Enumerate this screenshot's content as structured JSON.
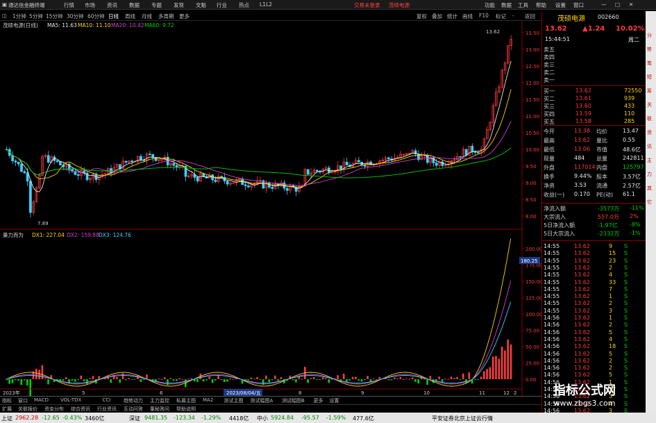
{
  "menubar": {
    "app": "通达信金融终端",
    "items": [
      "行情",
      "市场",
      "资讯",
      "数据",
      "专题",
      "发现",
      "文魁",
      "行业",
      "热点",
      "L1L2"
    ],
    "trade": "交易未登录",
    "stock_title": "茂硕电源",
    "right_items": [
      "功能",
      "数据",
      "工具",
      "帮助"
    ],
    "right2": [
      "设置",
      "窗口"
    ]
  },
  "tabbar": {
    "periods": [
      "1分钟",
      "5分钟",
      "15分钟",
      "30分钟",
      "60分钟",
      "日线",
      "周线",
      "月线",
      "多周期",
      "更多"
    ],
    "right": [
      "复权",
      "叠加",
      "统计",
      "画线",
      "F10",
      "标记",
      "-",
      "返回"
    ]
  },
  "kline": {
    "legend_name": "茂硕电源(日线)",
    "ma5": "MA5: 11.63",
    "ma10": "MA10: 11.10",
    "ma20": "MA20: 10.42",
    "ma60": "MA60: 9.72",
    "high_label": "13.62",
    "low_label": "7.89",
    "y_ticks": [
      "13.50",
      "13.00",
      "12.50",
      "12.00",
      "11.50",
      "11.00",
      "10.50",
      "10.00",
      "9.50",
      "9.00",
      "8.50",
      "8.00"
    ]
  },
  "indicator": {
    "name": "量力而为",
    "dx1": "DX1: 227.04",
    "dx2": "DX2: 159.88",
    "dx3": "DX3: 124.76",
    "cursor_value": "180.25",
    "y_ticks": [
      "200.00",
      "175.00",
      "150.00",
      "125.00",
      "100.00",
      "75.00",
      "50.00",
      "25.00",
      "0.00"
    ]
  },
  "date_axis": {
    "labels": [
      "2023年",
      "5",
      "6",
      "7",
      "8",
      "9",
      "10",
      "11",
      "12",
      "2"
    ],
    "cursor_date": "2023/08/04/五"
  },
  "bottom_tabs": [
    "指标",
    "窗口",
    "MACD",
    "VOL-TDX",
    "CCI",
    "趋势动力",
    "主力监控",
    "私募主图",
    "MA2",
    "测试主图",
    "测试幅图A",
    "测试幅图B",
    "更多",
    "设置"
  ],
  "bottom_tabs2": [
    "扩展",
    "关联报价",
    "资金分布",
    "综合资讯",
    "行业资讯",
    "互动问答",
    "董秘答问",
    "帮助说明"
  ],
  "quote": {
    "name": "茂硕电源",
    "code": "002660",
    "price": "13.62",
    "change": "▲1.24",
    "pct": "10.02%",
    "sell": [
      [
        "卖五",
        ""
      ],
      [
        "卖四",
        ""
      ],
      [
        "卖三",
        ""
      ],
      [
        "卖二",
        ""
      ],
      [
        "卖一",
        ""
      ]
    ],
    "buy": [
      [
        "买一",
        "13.62",
        "72550"
      ],
      [
        "买二",
        "13.61",
        "939"
      ],
      [
        "买三",
        "13.60",
        "433"
      ],
      [
        "买四",
        "13.59",
        "110"
      ],
      [
        "买五",
        "13.58",
        "285"
      ]
    ],
    "stats": [
      [
        "今开",
        "13.38",
        "均价",
        "13.47"
      ],
      [
        "最高",
        "13.62",
        "量比",
        "0.55"
      ],
      [
        "最低",
        "13.06",
        "市值",
        "48.6亿"
      ],
      [
        "现量",
        "484",
        "总量",
        "242811"
      ],
      [
        "外盘",
        "117014",
        "内盘",
        "125797"
      ],
      [
        "换手",
        "9.44%",
        "股本",
        "3.57亿"
      ],
      [
        "净资",
        "3.53",
        "流通",
        "2.57亿"
      ],
      [
        "收益(一)",
        "0.170",
        "PE(动)",
        "61.1"
      ]
    ],
    "flow": [
      [
        "净流入额",
        "-3573万",
        "-11%"
      ],
      [
        "大宗流入",
        "557.0万",
        "2%"
      ],
      [
        "5日净流入额",
        "-1.97亿",
        "-8%"
      ],
      [
        "5日大宗流入",
        "-2332万",
        "-1%"
      ]
    ],
    "ticks": [
      [
        "14:55",
        "13.62",
        "9",
        "S"
      ],
      [
        "14:55",
        "13.62",
        "15",
        "S"
      ],
      [
        "14:55",
        "13.62",
        "23",
        "S"
      ],
      [
        "14:55",
        "13.62",
        "2",
        "S"
      ],
      [
        "14:55",
        "13.62",
        "4",
        "S"
      ],
      [
        "14:55",
        "13.62",
        "33",
        "S"
      ],
      [
        "14:55",
        "13.62",
        "7",
        "S"
      ],
      [
        "14:55",
        "13.62",
        "1",
        "S"
      ],
      [
        "14:55",
        "13.62",
        "2",
        "S"
      ],
      [
        "14:55",
        "13.62",
        "3",
        "S"
      ],
      [
        "14:56",
        "13.62",
        "1",
        "S"
      ],
      [
        "14:56",
        "13.62",
        "2",
        "S"
      ],
      [
        "14:56",
        "13.62",
        "5",
        "S"
      ],
      [
        "14:56",
        "13.62",
        "4",
        "S"
      ],
      [
        "14:56",
        "13.62",
        "18",
        "S"
      ],
      [
        "14:56",
        "13.62",
        "5",
        "S"
      ],
      [
        "14:56",
        "13.62",
        "2",
        "S"
      ],
      [
        "14:56",
        "13.62",
        "2",
        "S"
      ],
      [
        "14:56",
        "13.62",
        "5",
        "S"
      ],
      [
        "14:56",
        "13.62",
        "1",
        "S"
      ],
      [
        "14:56",
        "13.62",
        "17",
        "S"
      ],
      [
        "14:56",
        "13.62",
        "3",
        "S"
      ],
      [
        "14:56",
        "13.62",
        "4",
        "S"
      ],
      [
        "14:56",
        "13.62",
        "3",
        "S"
      ]
    ],
    "time": "15:44:51",
    "weekday": "周二"
  },
  "statusbar": {
    "sh": "上证",
    "sh_val": "2962.28",
    "sh_chg": "-12.65",
    "sh_pct": "-0.43%",
    "sh_amt": "3460亿",
    "sz": "深证",
    "sz_val": "9481.35",
    "sz_chg": "-123.34",
    "sz_pct": "-1.29%",
    "sz_amt": "4418亿",
    "zx": "中小",
    "zx_val": "5924.84",
    "zx_chg": "-95.57",
    "zx_pct": "-1.59%",
    "zx_amt": "477.6亿",
    "right": "平安证券北京上证云行情"
  },
  "watermark": {
    "line1": "指标公式网",
    "line2": "www.zbgs3.com"
  },
  "side_tabs": [
    "分",
    "势",
    "笔",
    "短",
    "筹",
    "关",
    "联",
    "资",
    "讯",
    "主",
    "力",
    "其",
    "它"
  ],
  "colors": {
    "red": "#ff3b3b",
    "green": "#00d000",
    "yellow": "#ffd500",
    "cyan": "#3fd0ff",
    "magenta": "#d040d0",
    "darkred": "#800000"
  }
}
